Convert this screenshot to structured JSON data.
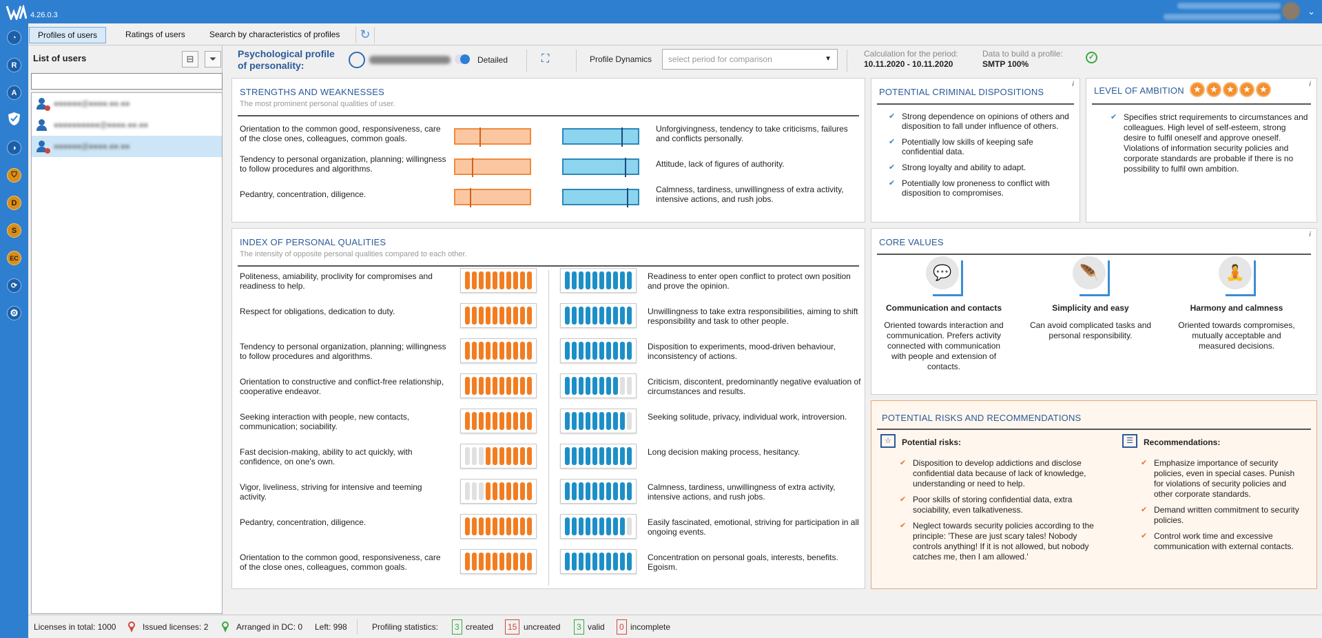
{
  "app": {
    "version": "4.26.0.3"
  },
  "rail": {
    "items": [
      {
        "letter": "",
        "icon": "dashboard-icon"
      },
      {
        "letter": "R",
        "icon": "r-module-icon"
      },
      {
        "letter": "A",
        "icon": "a-module-icon"
      },
      {
        "letter": "",
        "icon": "shield-icon"
      },
      {
        "letter": "",
        "icon": "profile-icon"
      },
      {
        "letter": "",
        "icon": "shield-orange-icon"
      },
      {
        "letter": "D",
        "icon": "d-module-icon"
      },
      {
        "letter": "S",
        "icon": "s-module-icon"
      },
      {
        "letter": "EC",
        "icon": "ec-module-icon"
      },
      {
        "letter": "",
        "icon": "sync-icon"
      },
      {
        "letter": "",
        "icon": "settings-icon"
      }
    ]
  },
  "tabs": [
    {
      "label": "Profiles of users"
    },
    {
      "label": "Ratings of users"
    },
    {
      "label": "Search by characteristics of profiles"
    }
  ],
  "users_panel": {
    "title": "List of users",
    "search_value": "",
    "users": [
      {
        "name": "●●●●●●@●●●●.●●.●●"
      },
      {
        "name": "●●●●●●●●●●@●●●●.●●.●●"
      },
      {
        "name": "●●●●●●@●●●●.●●.●●"
      }
    ]
  },
  "profile_header": {
    "title_line1": "Psychological profile",
    "title_line2": "of personality:",
    "user_email": "●●●●●●●@●●●●.●●.●●",
    "mode_label": "Detailed",
    "dynamics_label": "Profile Dynamics",
    "compare_placeholder": "select period for comparison",
    "period_label": "Calculation for the period:",
    "period_value": "10.11.2020 - 10.11.2020",
    "data_label": "Data to build a profile:",
    "data_value": "SMTP 100%"
  },
  "strengths": {
    "title": "STRENGTHS AND WEAKNESSES",
    "subtitle": "The most prominent personal qualities of user.",
    "rows": [
      {
        "left": "Orientation to the common good, responsiveness, care of the close ones, colleagues, common goals.",
        "right": "Unforgivingness, tendency to take criticisms, failures and conflicts personally.",
        "left_level": 0.32,
        "right_level": 0.78
      },
      {
        "left": "Tendency to personal organization, planning; willingness to follow procedures and algorithms.",
        "right": "Attitude, lack of figures of authority.",
        "left_level": 0.22,
        "right_level": 0.82
      },
      {
        "left": "Pedantry, concentration, diligence.",
        "right": "Calmness, tardiness, unwillingness of extra activity, intensive actions, and rush jobs.",
        "left_level": 0.19,
        "right_level": 0.85
      }
    ]
  },
  "criminal": {
    "title": "POTENTIAL CRIMINAL DISPOSITIONS",
    "items": [
      "Strong dependence on opinions of others and disposition to fall under influence of others.",
      "Potentially low skills of keeping safe confidential data.",
      "Strong loyalty and ability to adapt.",
      "Potentially low proneness to conflict with disposition to compromises."
    ]
  },
  "ambition": {
    "title": "LEVEL OF AMBITION",
    "stars": 5,
    "items": [
      "Specifies strict requirements to circumstances and colleagues. High level of self-esteem, strong desire to fulfil oneself and approve oneself. Violations of information security policies and corporate standards are probable if there is no possibility to fulfil own ambition."
    ]
  },
  "index": {
    "title": "INDEX OF PERSONAL QUALITIES",
    "subtitle": "The intensity of opposite personal qualities compared to each other.",
    "rows": [
      {
        "left": "Politeness, amiability, proclivity for compromises and readiness to help.",
        "right": "Readiness to enter open conflict to protect own position and prove the opinion.",
        "left_on": 10,
        "right_on": 10
      },
      {
        "left": "Respect for obligations, dedication to duty.",
        "right": "Unwillingness to take extra responsibilities, aiming to shift responsibility and task to other people.",
        "left_on": 10,
        "right_on": 10
      },
      {
        "left": "Tendency to personal organization, planning; willingness to follow procedures and algorithms.",
        "right": "Disposition to experiments, mood-driven behaviour, inconsistency of actions.",
        "left_on": 10,
        "right_on": 10
      },
      {
        "left": "Orientation to constructive and conflict-free relationship, cooperative endeavor.",
        "right": "Criticism, discontent, predominantly negative evaluation of circumstances and results.",
        "left_on": 10,
        "right_on": 8
      },
      {
        "left": "Seeking interaction with people, new contacts, communication; sociability.",
        "right": "Seeking solitude, privacy, individual work, introversion.",
        "left_on": 10,
        "right_on": 9
      },
      {
        "left": "Fast decision-making, ability to act quickly, with confidence, on one's own.",
        "right": "Long decision making process, hesitancy.",
        "left_on": 7,
        "right_on": 10
      },
      {
        "left": "Vigor, liveliness, striving for intensive and teeming activity.",
        "right": "Calmness, tardiness, unwillingness of extra activity, intensive actions, and rush jobs.",
        "left_on": 7,
        "right_on": 10
      },
      {
        "left": "Pedantry, concentration, diligence.",
        "right": "Easily fascinated, emotional, striving for participation in all ongoing events.",
        "left_on": 10,
        "right_on": 9
      },
      {
        "left": "Orientation to the common good, responsiveness, care of the close ones, colleagues, common goals.",
        "right": "Concentration on personal goals, interests, benefits. Egoism.",
        "left_on": 10,
        "right_on": 10
      }
    ]
  },
  "core_values": {
    "title": "CORE VALUES",
    "items": [
      {
        "name": "Communication and contacts",
        "desc": "Oriented towards interaction and communication. Prefers activity connected with communication with people and extension of contacts.",
        "icon": "speech-bubbles-icon"
      },
      {
        "name": "Simplicity and easy",
        "desc": "Can avoid complicated tasks and personal responsibility.",
        "icon": "feather-icon"
      },
      {
        "name": "Harmony and calmness",
        "desc": "Oriented towards compromises, mutually acceptable and measured decisions.",
        "icon": "meditation-icon"
      }
    ]
  },
  "risks": {
    "title": "POTENTIAL RISKS AND RECOMMENDATIONS",
    "risks_label": "Potential risks:",
    "recs_label": "Recommendations:",
    "risks": [
      "Disposition to develop addictions and disclose confidential data because of lack of knowledge, understanding or need to help.",
      "Poor skills of storing confidential data, extra sociability, even talkativeness.",
      "Neglect towards security policies according to the principle: 'These are just scary tales! Nobody controls anything! If it is not allowed, but nobody catches me, then I am allowed.'"
    ],
    "recommendations": [
      "Emphasize importance of security policies, even in special cases. Punish for violations of security policies and other corporate standards.",
      "Demand written commitment to security policies.",
      "Control work time and excessive communication with external contacts."
    ]
  },
  "status_bar": {
    "licenses_total": "Licenses in total: 1000",
    "issued": "Issued licenses: 2",
    "arranged": "Arranged in DC: 0",
    "left": "Left: 998",
    "stats_label": "Profiling statistics:",
    "created_count": "3",
    "created_label": "created",
    "uncreated_count": "15",
    "uncreated_label": "uncreated",
    "valid_count": "3",
    "valid_label": "valid",
    "incomplete_count": "0",
    "incomplete_label": "incomplete"
  },
  "colors": {
    "accent": "#2e7fd0",
    "orange": "#f27d21",
    "blue_bar": "#1d8fc7"
  }
}
